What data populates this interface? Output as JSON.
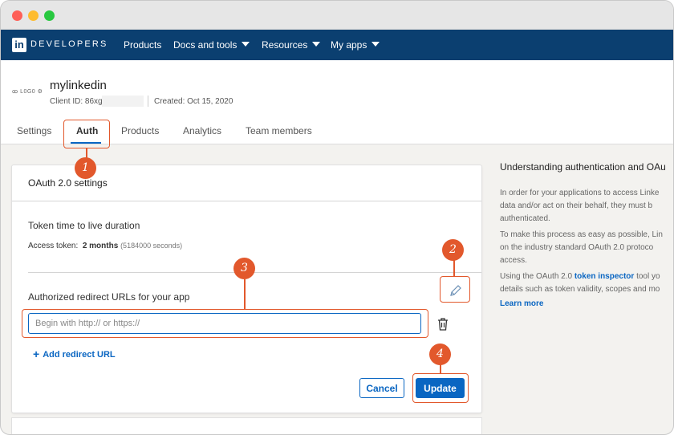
{
  "nav": {
    "brand": "DEVELOPERS",
    "logo_letter": "in",
    "items": [
      {
        "label": "Products",
        "has_caret": false
      },
      {
        "label": "Docs and tools",
        "has_caret": true
      },
      {
        "label": "Resources",
        "has_caret": true
      },
      {
        "label": "My apps",
        "has_caret": true
      }
    ]
  },
  "app": {
    "logo_text": "ꝏ L0G0 ⚙",
    "name": "mylinkedin",
    "client_id_label": "Client ID: 86xg",
    "created_label": "Created: Oct 15, 2020"
  },
  "tabs": [
    {
      "label": "Settings",
      "active": false
    },
    {
      "label": "Auth",
      "active": true
    },
    {
      "label": "Products",
      "active": false
    },
    {
      "label": "Analytics",
      "active": false
    },
    {
      "label": "Team members",
      "active": false
    }
  ],
  "oauth": {
    "title": "OAuth 2.0 settings",
    "token_section_title": "Token time to live duration",
    "access_token_label": "Access token:",
    "access_token_value": "2 months",
    "access_token_seconds": "(5184000 seconds)",
    "redirect_section_title": "Authorized redirect URLs for your app",
    "redirect_placeholder": "Begin with http:// or https://",
    "add_redirect_label": "Add redirect URL",
    "cancel_label": "Cancel",
    "update_label": "Update"
  },
  "sidebar": {
    "title": "Understanding authentication and OAu",
    "para1": [
      "In order for your applications to access Linke",
      "data and/or act on their behalf, they must b",
      "authenticated."
    ],
    "para2": [
      "To make this process as easy as possible, Lin",
      "on the industry standard OAuth 2.0 protoco",
      "access."
    ],
    "para3_prefix": "Using the OAuth 2.0 ",
    "para3_link": "token inspector",
    "para3_suffix": " tool yo",
    "para3_line2": "details such as token validity, scopes and mo",
    "learn_more": "Learn more"
  },
  "annotations": [
    "1",
    "2",
    "3",
    "4"
  ],
  "colors": {
    "nav_bg": "#0b3f70",
    "accent": "#0a66c2",
    "annotation": "#e2582c"
  }
}
